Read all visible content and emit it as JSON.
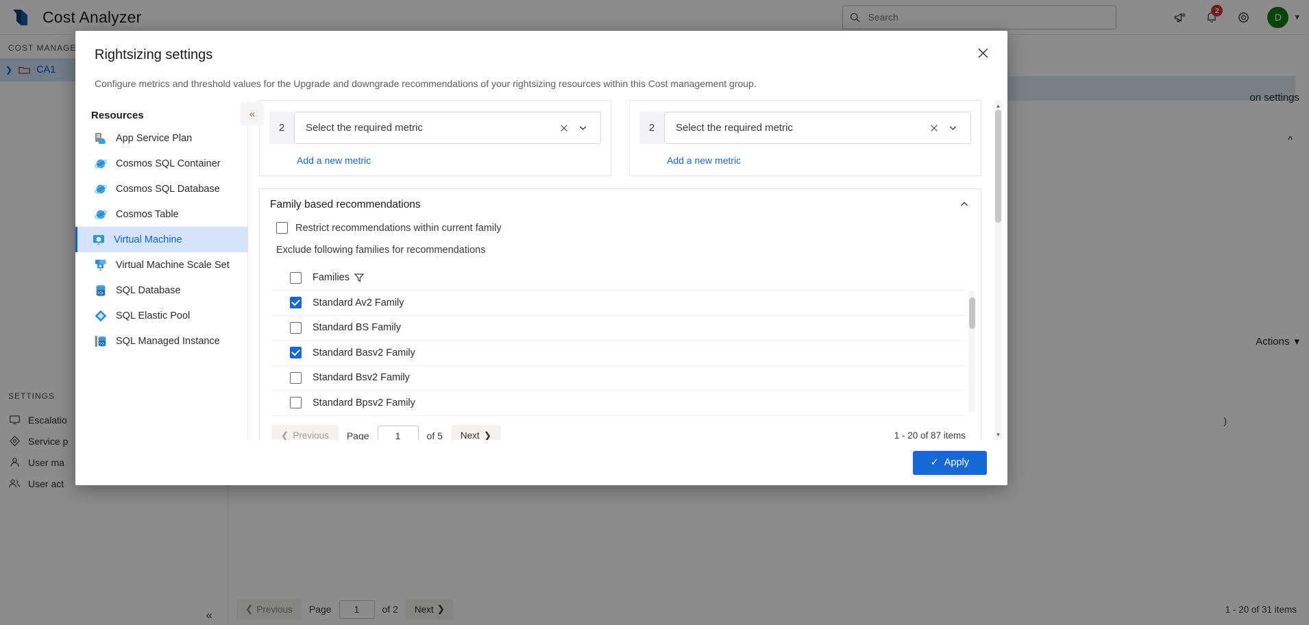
{
  "app": {
    "title": "Cost Analyzer",
    "logo_icon": "azure-logo-icon"
  },
  "topbar": {
    "search_placeholder": "Search",
    "search_value": "",
    "search_icon": "search-icon",
    "feedback_icon": "megaphone-icon",
    "notifications_icon": "bell-icon",
    "notifications_badge": "2",
    "settings_icon": "gear-icon",
    "avatar_initial": "D",
    "avatar_color": "#107c10",
    "avatar_caret_icon": "chevron-down-icon"
  },
  "leftnav": {
    "section_title": "COST MANAGE",
    "tree_item": "CA1",
    "tree_expand_icon": "chevron-right-icon",
    "folder_icon": "folder-icon",
    "settings_title": "SETTINGS",
    "settings_items": [
      {
        "label": "Escalatio",
        "icon": "monitor-icon"
      },
      {
        "label": "Service p",
        "icon": "diamond-icon"
      },
      {
        "label": "User ma",
        "icon": "user-icon"
      },
      {
        "label": "User act",
        "icon": "users-icon"
      }
    ],
    "collapse_icon": "double-chevron-left-icon"
  },
  "background": {
    "settings_link": "on settings",
    "section_label": "on",
    "actions_label": "Actions",
    "actions_caret_icon": "chevron-down-icon",
    "paren_text": ")",
    "collapse_chevron_icon": "chevron-up-icon",
    "pager": {
      "previous": "Previous",
      "page_label": "Page",
      "page_value": "1",
      "of_label": "of 2",
      "next": "Next",
      "items_count": "1 - 20 of 31 items",
      "prev_icon": "chevron-left-icon",
      "next_icon": "chevron-right-icon"
    }
  },
  "modal": {
    "title": "Rightsizing settings",
    "subtitle": "Configure metrics and threshold values for the Upgrade and downgrade recommendations of your rightsizing resources within this Cost management group.",
    "close_icon": "close-icon",
    "sidebar": {
      "title": "Resources",
      "collapse_icon": "double-chevron-left-icon",
      "items": [
        {
          "label": "App Service Plan",
          "icon": "app-service-plan-icon",
          "selected": false
        },
        {
          "label": "Cosmos SQL Container",
          "icon": "cosmos-db-icon",
          "selected": false
        },
        {
          "label": "Cosmos SQL Database",
          "icon": "cosmos-db-icon",
          "selected": false
        },
        {
          "label": "Cosmos Table",
          "icon": "cosmos-db-icon",
          "selected": false
        },
        {
          "label": "Virtual Machine",
          "icon": "virtual-machine-icon",
          "selected": true
        },
        {
          "label": "Virtual Machine Scale Set",
          "icon": "vm-scale-set-icon",
          "selected": false
        },
        {
          "label": "SQL Database",
          "icon": "sql-database-icon",
          "selected": false
        },
        {
          "label": "SQL Elastic Pool",
          "icon": "sql-elastic-pool-icon",
          "selected": false
        },
        {
          "label": "SQL Managed Instance",
          "icon": "sql-managed-instance-icon",
          "selected": false
        }
      ]
    },
    "metrics": [
      {
        "number": "2",
        "value": "Select the required metric",
        "clear_icon": "close-icon",
        "chevron_icon": "chevron-down-icon",
        "add_link": "Add a new metric"
      },
      {
        "number": "2",
        "value": "Select the required metric",
        "clear_icon": "close-icon",
        "chevron_icon": "chevron-down-icon",
        "add_link": "Add a new metric"
      }
    ],
    "family_panel": {
      "title": "Family based recommendations",
      "collapse_icon": "chevron-up-icon",
      "restrict_label": "Restrict recommendations within current family",
      "restrict_checked": false,
      "exclude_label": "Exclude following families for recommendations",
      "table": {
        "header": "Families",
        "header_checked": false,
        "filter_icon": "filter-icon",
        "rows": [
          {
            "name": "Standard Av2 Family",
            "checked": true
          },
          {
            "name": "Standard BS Family",
            "checked": false
          },
          {
            "name": "Standard Basv2 Family",
            "checked": true
          },
          {
            "name": "Standard Bsv2 Family",
            "checked": false
          },
          {
            "name": "Standard Bpsv2 Family",
            "checked": false
          }
        ]
      },
      "pager": {
        "previous": "Previous",
        "page_label": "Page",
        "page_value": "1",
        "of_label": "of 5",
        "next": "Next",
        "items_count": "1 - 20 of 87 items",
        "prev_icon": "chevron-left-icon",
        "next_icon": "chevron-right-icon"
      }
    },
    "apply_label": "Apply",
    "apply_icon": "check-icon",
    "accent_color": "#1668d6"
  }
}
